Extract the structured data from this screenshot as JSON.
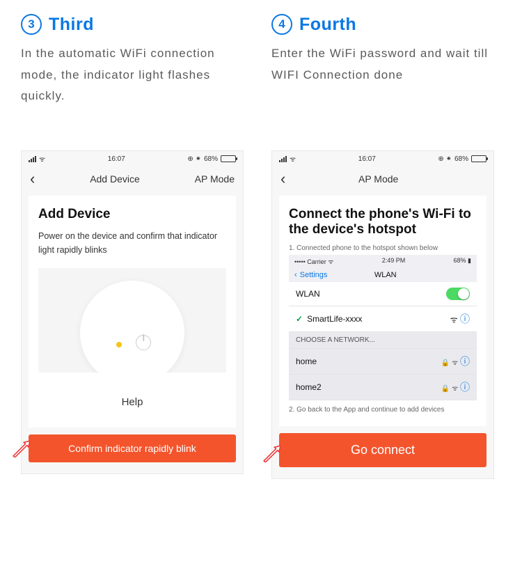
{
  "left": {
    "num": "3",
    "title": "Third",
    "desc": "In the automatic WiFi connection mode, the indicator light flashes quickly.",
    "status": {
      "time": "16:07",
      "battery": "68%"
    },
    "nav": {
      "title": "Add Device",
      "mode": "AP Mode"
    },
    "card": {
      "heading": "Add Device",
      "sub": "Power on the device and confirm that indicator light rapidly blinks",
      "help": "Help"
    },
    "button": "Confirm indicator rapidly blink"
  },
  "right": {
    "num": "4",
    "title": "Fourth",
    "desc": "Enter the WiFi password and wait till WIFI Connection done",
    "status": {
      "time": "16:07",
      "battery": "68%"
    },
    "nav": {
      "title": "AP Mode"
    },
    "card": {
      "heading": "Connect the phone's Wi-Fi to the device's hotspot",
      "step1": "1. Connected phone to the hotspot shown below",
      "step2": "2. Go back to the App and continue to add devices",
      "settings": {
        "carrier": "Carrier",
        "time": "2:49 PM",
        "battery": "68%",
        "back": "Settings",
        "title": "WLAN",
        "wlan": "WLAN",
        "connected": "SmartLife-xxxx",
        "choose": "CHOOSE A NETWORK...",
        "net1": "home",
        "net2": "home2"
      }
    },
    "button": "Go connect"
  }
}
